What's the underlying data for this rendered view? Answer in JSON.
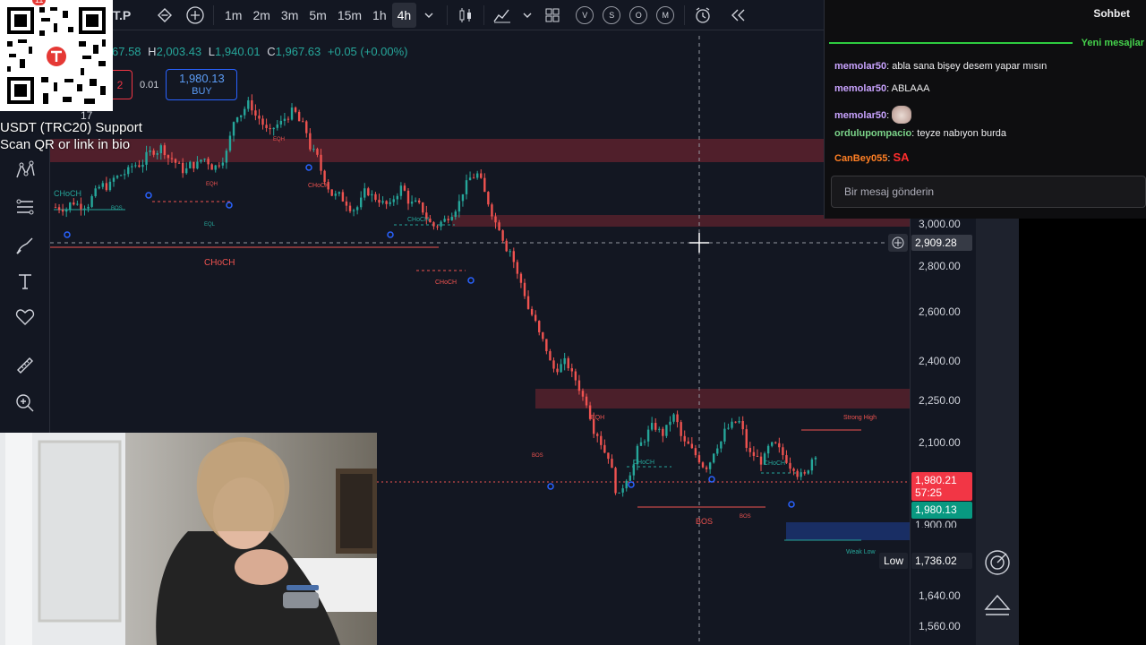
{
  "toolbar": {
    "symbol_suffix": "T.P",
    "timeframes": [
      "1m",
      "2m",
      "3m",
      "5m",
      "15m",
      "1h",
      "4h"
    ],
    "active_timeframe": "4h",
    "circle_buttons": [
      "V",
      "S",
      "O",
      "M"
    ]
  },
  "ohlc": {
    "open": "67.58",
    "high_label": "H",
    "high": "2,003.43",
    "low_label": "L",
    "low": "1,940.01",
    "close_label": "C",
    "close": "1,967.63",
    "change": "+0.05 (+0.00%)"
  },
  "trade": {
    "sell_value": "2",
    "spread": "0.01",
    "buy_price": "1,980.13",
    "buy_label": "BUY"
  },
  "legend_partial": "17",
  "price_axis": {
    "ticks": [
      "3,000.00",
      "2,800.00",
      "2,600.00",
      "2,400.00",
      "2,250.00",
      "2,100.00",
      "1,640.00",
      "1,560.00"
    ],
    "crosshair_price": "2,909.28",
    "current_price": "1,980.21",
    "countdown": "57:25",
    "bid_price": "1,980.13",
    "partial_price": "1,900.00",
    "low_tag": "Low",
    "low_price": "1,736.02"
  },
  "chart_labels": {
    "choch": "CHoCH",
    "bos": "BOS",
    "eqh": "EQH",
    "eql": "EQL",
    "strong_high": "Strong High",
    "weak_low": "Weak Low"
  },
  "chart_data": {
    "type": "candlestick",
    "note_series": "approximate closing path of the visible candles",
    "y_range": [
      1520,
      3150
    ],
    "x": [
      1,
      2,
      3,
      4,
      5,
      6,
      7,
      8,
      9,
      10,
      11,
      12,
      13,
      14,
      15,
      16,
      17,
      18,
      19,
      20,
      21,
      22,
      23,
      24,
      25,
      26,
      27,
      28,
      29,
      30,
      31,
      32,
      33,
      34,
      35,
      36,
      37,
      38,
      39,
      40,
      41,
      42,
      43,
      44,
      45,
      46,
      47,
      48,
      49,
      50,
      51,
      52,
      53,
      54,
      55,
      56,
      57,
      58,
      59,
      60,
      61,
      62,
      63,
      64,
      65,
      66,
      67,
      68,
      69,
      70
    ],
    "close": [
      2880,
      2900,
      2890,
      2930,
      2960,
      2990,
      3010,
      3040,
      3080,
      3100,
      3060,
      3020,
      3040,
      3060,
      3030,
      3080,
      3230,
      3260,
      3210,
      3150,
      3190,
      3230,
      3180,
      3080,
      2990,
      2920,
      2900,
      2880,
      2940,
      2910,
      2880,
      2950,
      2890,
      2870,
      2810,
      2830,
      2880,
      2960,
      3000,
      2900,
      2810,
      2720,
      2600,
      2480,
      2380,
      2280,
      2300,
      2240,
      2160,
      2040,
      1960,
      1800,
      1900,
      2000,
      2060,
      2040,
      2100,
      2000,
      1960,
      1920,
      2000,
      2060,
      2080,
      1960,
      1940,
      1990,
      1960,
      1920,
      1880,
      1970
    ],
    "zones": [
      {
        "type": "supply",
        "from": 3120,
        "to": 3180
      },
      {
        "type": "supply",
        "from": 3000,
        "to": 3030
      },
      {
        "type": "supply",
        "from": 2220,
        "to": 2270
      },
      {
        "type": "demand",
        "from": 1745,
        "to": 1790
      }
    ]
  },
  "chat": {
    "title": "Sohbet",
    "new_messages": "Yeni mesajlar",
    "messages": [
      {
        "user": "memolar50",
        "color": "#c9a3ff",
        "text": "abla sana bişey desem yapar mısın"
      },
      {
        "user": "memolar50",
        "color": "#c9a3ff",
        "text": "ABLAAA"
      },
      {
        "user": "memolar50",
        "color": "#c9a3ff",
        "text": ""
      },
      {
        "user": "ordulupompacio",
        "color": "#7bd389",
        "text": "teyze nabıyon burda"
      },
      {
        "user": "CanBey055",
        "color": "#ff7f24",
        "text": "SA"
      }
    ],
    "input_placeholder": "Bir mesaj gönderin"
  },
  "overlay": {
    "qr_line1": "USDT (TRC20) Support",
    "qr_line2": "Scan QR or link in bio",
    "qr_badge": "11"
  },
  "colors": {
    "bg": "#131722",
    "up": "#26a69a",
    "down": "#ef5350",
    "supply_zone": "#f2364540",
    "demand_zone": "#2962ff40",
    "accent": "#2962ff"
  }
}
